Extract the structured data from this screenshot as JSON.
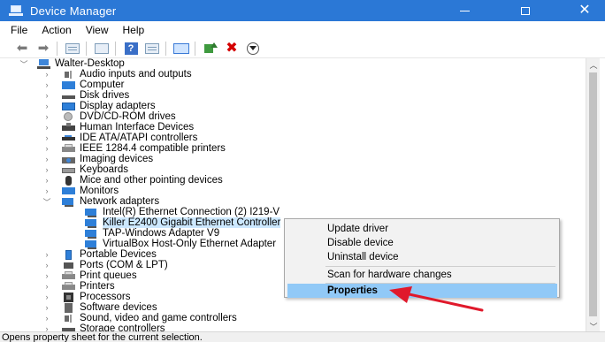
{
  "window": {
    "title": "Device Manager",
    "minimize_icon": "minimize-icon",
    "maximize_icon": "maximize-icon",
    "close_icon": "close-icon"
  },
  "menu": [
    "File",
    "Action",
    "View",
    "Help"
  ],
  "toolbar": {
    "buttons": [
      "back-arrow-icon",
      "forward-arrow-icon",
      "device-list-icon",
      "properties-icon",
      "help-icon",
      "resources-icon",
      "monitor-icon",
      "update-driver-icon",
      "uninstall-icon",
      "scan-download-icon"
    ]
  },
  "tree": {
    "root": "Walter-Desktop",
    "categories": [
      {
        "label": "Audio inputs and outputs",
        "icon": "speaker-icon"
      },
      {
        "label": "Computer",
        "icon": "computer-icon"
      },
      {
        "label": "Disk drives",
        "icon": "disk-icon"
      },
      {
        "label": "Display adapters",
        "icon": "display-icon"
      },
      {
        "label": "DVD/CD-ROM drives",
        "icon": "dvd-icon"
      },
      {
        "label": "Human Interface Devices",
        "icon": "hid-icon"
      },
      {
        "label": "IDE ATA/ATAPI controllers",
        "icon": "ide-icon"
      },
      {
        "label": "IEEE 1284.4 compatible printers",
        "icon": "printer-icon"
      },
      {
        "label": "Imaging devices",
        "icon": "camera-icon"
      },
      {
        "label": "Keyboards",
        "icon": "keyboard-icon"
      },
      {
        "label": "Mice and other pointing devices",
        "icon": "mouse-icon"
      },
      {
        "label": "Monitors",
        "icon": "monitor-icon"
      },
      {
        "label": "Network adapters",
        "icon": "network-icon"
      }
    ],
    "network_adapters": [
      "Intel(R) Ethernet Connection (2) I219-V",
      "Killer E2400 Gigabit Ethernet Controller",
      "TAP-Windows Adapter V9",
      "VirtualBox Host-Only Ethernet Adapter"
    ],
    "after": [
      {
        "label": "Portable Devices",
        "icon": "portable-device-icon"
      },
      {
        "label": "Ports (COM & LPT)",
        "icon": "port-icon"
      },
      {
        "label": "Print queues",
        "icon": "printer-icon"
      },
      {
        "label": "Printers",
        "icon": "printer-icon"
      },
      {
        "label": "Processors",
        "icon": "processor-icon"
      },
      {
        "label": "Software devices",
        "icon": "software-icon"
      },
      {
        "label": "Sound, video and game controllers",
        "icon": "speaker-icon"
      },
      {
        "label": "Storage controllers",
        "icon": "storage-icon"
      }
    ]
  },
  "context_menu": {
    "items": [
      "Update driver",
      "Disable device",
      "Uninstall device",
      "Scan for hardware changes",
      "Properties"
    ]
  },
  "status": "Opens property sheet for the current selection.",
  "colors": {
    "titlebar": "#2b78d6",
    "selection": "#cce8ff",
    "menu_highlight": "#91c9f7",
    "arrow": "#e0192b"
  }
}
